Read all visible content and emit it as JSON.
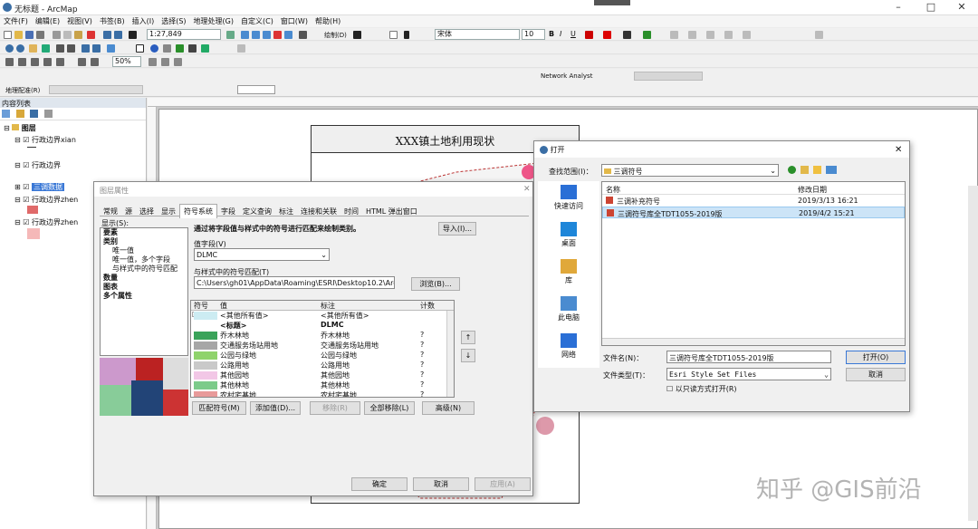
{
  "app": {
    "title": "无标题 - ArcMap"
  },
  "menus": [
    "文件(F)",
    "编辑(E)",
    "视图(V)",
    "书签(B)",
    "插入(I)",
    "选择(S)",
    "地理处理(G)",
    "自定义(C)",
    "窗口(W)",
    "帮助(H)"
  ],
  "toolbar": {
    "scale": "1:27,849",
    "draw_label": "绘制(D)",
    "font": "宋体",
    "size": "10",
    "zoom": "50%",
    "network": "Network Analyst",
    "georef": "地理配准(R)"
  },
  "toc": {
    "title": "内容列表",
    "root": "图层",
    "layers": [
      "行政边界xian",
      "行政边界",
      "三调数据",
      "行政边界zhen",
      "行政边界zhen"
    ]
  },
  "layout": {
    "map_title": "XXX镇土地利用现状"
  },
  "layer_props": {
    "title": "图层属性",
    "tabs": [
      "常规",
      "源",
      "选择",
      "显示",
      "符号系统",
      "字段",
      "定义查询",
      "标注",
      "连接和关联",
      "时间",
      "HTML 弹出窗口"
    ],
    "show_label": "显示(S):",
    "show_items": [
      "要素",
      "类别",
      "唯一值",
      "唯一值，多个字段",
      "与样式中的符号匹配",
      "数量",
      "图表",
      "多个属性"
    ],
    "desc": "通过将字段值与样式中的符号进行匹配来绘制类别。",
    "import_btn": "导入(I)...",
    "value_field_label": "值字段(V)",
    "value_field": "DLMC",
    "match_label": "与样式中的符号匹配(T)",
    "match_path": "C:\\Users\\gh01\\AppData\\Roaming\\ESRI\\Desktop10.2\\ArcMap",
    "browse_btn": "浏览(B)...",
    "columns": [
      "符号",
      "值",
      "标注",
      "计数"
    ],
    "rows": [
      {
        "value": "<其他所有值>",
        "label": "<其他所有值>",
        "count": "",
        "color": "#ccecf2"
      },
      {
        "value": "<标题>",
        "label": "DLMC",
        "count": "",
        "color": ""
      },
      {
        "value": "乔木林地",
        "label": "乔木林地",
        "count": "?",
        "color": "#3aa35a"
      },
      {
        "value": "交通服务场站用地",
        "label": "交通服务场站用地",
        "count": "?",
        "color": "#a6a6a6"
      },
      {
        "value": "公园与绿地",
        "label": "公园与绿地",
        "count": "?",
        "color": "#8fd36b"
      },
      {
        "value": "公路用地",
        "label": "公路用地",
        "count": "?",
        "color": "#c9c9c9"
      },
      {
        "value": "其他园地",
        "label": "其他园地",
        "count": "?",
        "color": "#f2c7e6"
      },
      {
        "value": "其他林地",
        "label": "其他林地",
        "count": "?",
        "color": "#7ccb8a"
      },
      {
        "value": "农村宅基地",
        "label": "农村宅基地",
        "count": "?",
        "color": "#e89a9a"
      }
    ],
    "btns": [
      "匹配符号(M)",
      "添加值(D)...",
      "移除(R)",
      "全部移除(L)",
      "高级(N)"
    ],
    "ok": "确定",
    "cancel": "取消",
    "apply": "应用(A)"
  },
  "open_dlg": {
    "title": "打开",
    "lookin_label": "查找范围(I)：",
    "lookin": "三调符号",
    "places": [
      "快速访问",
      "桌面",
      "库",
      "此电脑",
      "网络"
    ],
    "columns": [
      "名称",
      "修改日期"
    ],
    "files": [
      {
        "name": "三调补充符号",
        "date": "2019/3/13 16:21",
        "selected": false
      },
      {
        "name": "三调符号库全TDT1055-2019版",
        "date": "2019/4/2 15:21",
        "selected": true
      }
    ],
    "filename_label": "文件名(N)：",
    "filename": "三调符号库全TDT1055-2019版",
    "filetype_label": "文件类型(T)：",
    "filetype": "Esri Style Set Files",
    "readonly": "以只读方式打开(R)",
    "open_btn": "打开(O)",
    "cancel_btn": "取消"
  },
  "watermark": "知乎 @GIS前沿"
}
